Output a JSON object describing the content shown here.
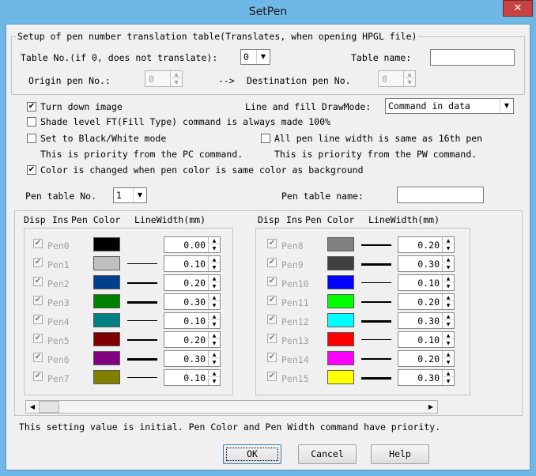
{
  "window": {
    "title": "SetPen",
    "close_glyph": "✕"
  },
  "translation_group": {
    "title": "Setup of pen number translation table(Translates, when opening HPGL file)",
    "table_no_label": "Table No.(if 0, does not translate):",
    "table_no_value": "0",
    "table_name_label": "Table name:",
    "table_name_value": "",
    "origin_label": "Origin pen No.:",
    "origin_value": "0",
    "arrow_label": "-->",
    "dest_label": "Destination pen No.",
    "dest_value": "0"
  },
  "options": {
    "turn_down_label": "Turn down image",
    "turn_down_checked": "✔",
    "drawmode_label": "Line and fill DrawMode:",
    "drawmode_value": "Command in data",
    "shade_label": "Shade level FT(Fill Type) command is always made 100%",
    "shade_checked": "",
    "bw_label": "Set to Black/White mode",
    "bw_checked": "",
    "bw_note": "This is priority from the PC command.",
    "pen16_label": "All pen line width is same as 16th pen",
    "pen16_checked": "",
    "pen16_note": "This is priority from the PW command.",
    "color_change_label": "Color is changed when pen color is same color as background",
    "color_change_checked": "✔"
  },
  "pen_table": {
    "no_label": "Pen table No.",
    "no_value": "1",
    "name_label": "Pen table name:",
    "name_value": ""
  },
  "headers": {
    "disp": "Disp",
    "ins": "Ins",
    "pen_color": "Pen Color",
    "line_width": "LineWidth(mm)"
  },
  "check_glyph": "✔",
  "pens_left": [
    {
      "label": "Pen0",
      "color": "#000000",
      "width": "0.00",
      "thick": 0
    },
    {
      "label": "Pen1",
      "color": "#c0c0c0",
      "width": "0.10",
      "thick": 1
    },
    {
      "label": "Pen2",
      "color": "#00408a",
      "width": "0.20",
      "thick": 2
    },
    {
      "label": "Pen3",
      "color": "#008000",
      "width": "0.30",
      "thick": 3
    },
    {
      "label": "Pen4",
      "color": "#008080",
      "width": "0.10",
      "thick": 1
    },
    {
      "label": "Pen5",
      "color": "#800000",
      "width": "0.20",
      "thick": 2
    },
    {
      "label": "Pen6",
      "color": "#800080",
      "width": "0.30",
      "thick": 3
    },
    {
      "label": "Pen7",
      "color": "#808000",
      "width": "0.10",
      "thick": 1
    }
  ],
  "pens_right": [
    {
      "label": "Pen8",
      "color": "#808080",
      "width": "0.20",
      "thick": 2
    },
    {
      "label": "Pen9",
      "color": "#404040",
      "width": "0.30",
      "thick": 3
    },
    {
      "label": "Pen10",
      "color": "#0000ff",
      "width": "0.10",
      "thick": 1
    },
    {
      "label": "Pen11",
      "color": "#00ff00",
      "width": "0.20",
      "thick": 2
    },
    {
      "label": "Pen12",
      "color": "#00ffff",
      "width": "0.30",
      "thick": 3
    },
    {
      "label": "Pen13",
      "color": "#ff0000",
      "width": "0.10",
      "thick": 1
    },
    {
      "label": "Pen14",
      "color": "#ff00ff",
      "width": "0.20",
      "thick": 2
    },
    {
      "label": "Pen15",
      "color": "#ffff00",
      "width": "0.30",
      "thick": 3
    }
  ],
  "scroll": {
    "left_glyph": "◀",
    "right_glyph": "▶"
  },
  "footer_note": "This setting value is initial. Pen Color and Pen Width command have priority.",
  "buttons": {
    "ok": "OK",
    "cancel": "Cancel",
    "help": "Help"
  },
  "glyphs": {
    "down": "▼",
    "up": "▲"
  }
}
